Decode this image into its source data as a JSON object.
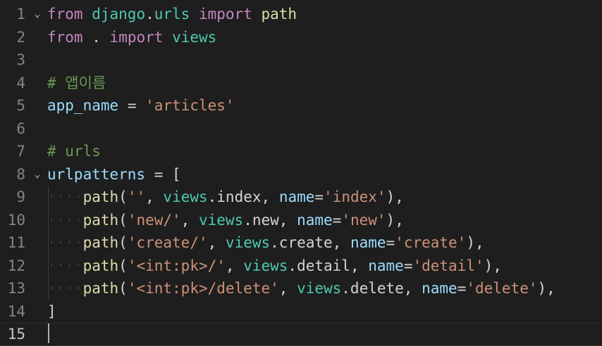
{
  "editor": {
    "lines": [
      {
        "num": "1",
        "fold": "⌄",
        "tokens": [
          {
            "t": "from",
            "c": "kw"
          },
          {
            "t": " ",
            "c": "ws"
          },
          {
            "t": "django",
            "c": "mod"
          },
          {
            "t": ".",
            "c": "op"
          },
          {
            "t": "urls",
            "c": "mod"
          },
          {
            "t": " ",
            "c": "ws"
          },
          {
            "t": "import",
            "c": "kw"
          },
          {
            "t": " ",
            "c": "ws"
          },
          {
            "t": "path",
            "c": "fn"
          }
        ]
      },
      {
        "num": "2",
        "fold": "",
        "tokens": [
          {
            "t": "from",
            "c": "kw"
          },
          {
            "t": " ",
            "c": "ws"
          },
          {
            "t": ".",
            "c": "op"
          },
          {
            "t": " ",
            "c": "ws"
          },
          {
            "t": "import",
            "c": "kw"
          },
          {
            "t": " ",
            "c": "ws"
          },
          {
            "t": "views",
            "c": "mod"
          }
        ]
      },
      {
        "num": "3",
        "fold": "",
        "tokens": []
      },
      {
        "num": "4",
        "fold": "",
        "tokens": [
          {
            "t": "# 앱이름",
            "c": "cmt"
          }
        ]
      },
      {
        "num": "5",
        "fold": "",
        "tokens": [
          {
            "t": "app_name",
            "c": "var"
          },
          {
            "t": " ",
            "c": "ws"
          },
          {
            "t": "=",
            "c": "op"
          },
          {
            "t": " ",
            "c": "ws"
          },
          {
            "t": "'articles'",
            "c": "str"
          }
        ]
      },
      {
        "num": "6",
        "fold": "",
        "tokens": []
      },
      {
        "num": "7",
        "fold": "",
        "tokens": [
          {
            "t": "# urls",
            "c": "cmt"
          }
        ]
      },
      {
        "num": "8",
        "fold": "⌄",
        "tokens": [
          {
            "t": "urlpatterns",
            "c": "var"
          },
          {
            "t": " ",
            "c": "ws"
          },
          {
            "t": "=",
            "c": "op"
          },
          {
            "t": " ",
            "c": "ws"
          },
          {
            "t": "[",
            "c": "op"
          }
        ]
      },
      {
        "num": "9",
        "fold": "",
        "tokens": [
          {
            "t": "····",
            "c": "ws"
          },
          {
            "t": "path",
            "c": "fn"
          },
          {
            "t": "(",
            "c": "op"
          },
          {
            "t": "''",
            "c": "str"
          },
          {
            "t": ",",
            "c": "op"
          },
          {
            "t": " ",
            "c": "ws"
          },
          {
            "t": "views",
            "c": "mod"
          },
          {
            "t": ".index",
            "c": "op"
          },
          {
            "t": ",",
            "c": "op"
          },
          {
            "t": " ",
            "c": "ws"
          },
          {
            "t": "name",
            "c": "var"
          },
          {
            "t": "=",
            "c": "op"
          },
          {
            "t": "'index'",
            "c": "str"
          },
          {
            "t": "),",
            "c": "op"
          }
        ]
      },
      {
        "num": "10",
        "fold": "",
        "tokens": [
          {
            "t": "····",
            "c": "ws"
          },
          {
            "t": "path",
            "c": "fn"
          },
          {
            "t": "(",
            "c": "op"
          },
          {
            "t": "'new/'",
            "c": "str"
          },
          {
            "t": ",",
            "c": "op"
          },
          {
            "t": " ",
            "c": "ws"
          },
          {
            "t": "views",
            "c": "mod"
          },
          {
            "t": ".new",
            "c": "op"
          },
          {
            "t": ",",
            "c": "op"
          },
          {
            "t": " ",
            "c": "ws"
          },
          {
            "t": "name",
            "c": "var"
          },
          {
            "t": "=",
            "c": "op"
          },
          {
            "t": "'new'",
            "c": "str"
          },
          {
            "t": "),",
            "c": "op"
          }
        ]
      },
      {
        "num": "11",
        "fold": "",
        "tokens": [
          {
            "t": "····",
            "c": "ws"
          },
          {
            "t": "path",
            "c": "fn"
          },
          {
            "t": "(",
            "c": "op"
          },
          {
            "t": "'create/'",
            "c": "str"
          },
          {
            "t": ",",
            "c": "op"
          },
          {
            "t": " ",
            "c": "ws"
          },
          {
            "t": "views",
            "c": "mod"
          },
          {
            "t": ".create",
            "c": "op"
          },
          {
            "t": ",",
            "c": "op"
          },
          {
            "t": " ",
            "c": "ws"
          },
          {
            "t": "name",
            "c": "var"
          },
          {
            "t": "=",
            "c": "op"
          },
          {
            "t": "'create'",
            "c": "str"
          },
          {
            "t": "),",
            "c": "op"
          }
        ]
      },
      {
        "num": "12",
        "fold": "",
        "tokens": [
          {
            "t": "····",
            "c": "ws"
          },
          {
            "t": "path",
            "c": "fn"
          },
          {
            "t": "(",
            "c": "op"
          },
          {
            "t": "'<int:pk>/'",
            "c": "str"
          },
          {
            "t": ",",
            "c": "op"
          },
          {
            "t": " ",
            "c": "ws"
          },
          {
            "t": "views",
            "c": "mod"
          },
          {
            "t": ".detail",
            "c": "op"
          },
          {
            "t": ",",
            "c": "op"
          },
          {
            "t": " ",
            "c": "ws"
          },
          {
            "t": "name",
            "c": "var"
          },
          {
            "t": "=",
            "c": "op"
          },
          {
            "t": "'detail'",
            "c": "str"
          },
          {
            "t": "),",
            "c": "op"
          }
        ]
      },
      {
        "num": "13",
        "fold": "",
        "tokens": [
          {
            "t": "····",
            "c": "ws"
          },
          {
            "t": "path",
            "c": "fn"
          },
          {
            "t": "(",
            "c": "op"
          },
          {
            "t": "'<int:pk>/delete'",
            "c": "str"
          },
          {
            "t": ",",
            "c": "op"
          },
          {
            "t": " ",
            "c": "ws"
          },
          {
            "t": "views",
            "c": "mod"
          },
          {
            "t": ".delete",
            "c": "op"
          },
          {
            "t": ",",
            "c": "op"
          },
          {
            "t": " ",
            "c": "ws"
          },
          {
            "t": "name",
            "c": "var"
          },
          {
            "t": "=",
            "c": "op"
          },
          {
            "t": "'delete'",
            "c": "str"
          },
          {
            "t": "),",
            "c": "op"
          }
        ]
      },
      {
        "num": "14",
        "fold": "",
        "tokens": [
          {
            "t": "]",
            "c": "op"
          }
        ]
      },
      {
        "num": "15",
        "fold": "",
        "current": true,
        "tokens": []
      }
    ]
  },
  "colors": {
    "background": "#1e1e1e",
    "keyword": "#c586c0",
    "module": "#4ec9b0",
    "function": "#dcdcaa",
    "variable": "#9cdcfe",
    "string": "#ce9178",
    "comment": "#6a9955",
    "line_number": "#858585"
  }
}
